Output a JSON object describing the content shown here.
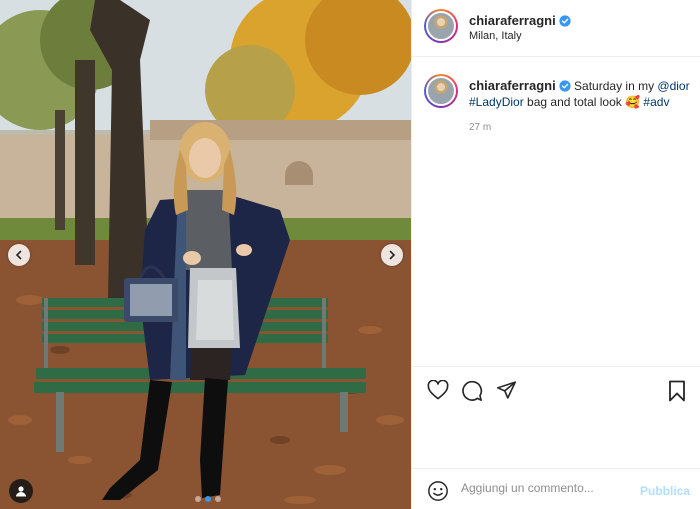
{
  "post": {
    "author": {
      "username": "chiaraferragni",
      "verified": true,
      "location": "Milan, Italy"
    },
    "caption": {
      "text_before": " Saturday in my ",
      "mention": "@dior",
      "hashtag1": "#LadyDior",
      "text_middle": " bag and total look ",
      "emoji": "🥰",
      "hashtag2": "#adv"
    },
    "time_ago": "27 m"
  },
  "media": {
    "carousel_index": 2,
    "carousel_count": 3
  },
  "actions": {
    "icons": [
      "heart-icon",
      "comment-icon",
      "share-icon",
      "bookmark-icon"
    ]
  },
  "comment": {
    "placeholder": "Aggiungi un commento...",
    "publish_label": "Pubblica"
  },
  "colors": {
    "verified": "#3897f0",
    "link": "#00376b",
    "publish_disabled": "#b2dffc"
  }
}
